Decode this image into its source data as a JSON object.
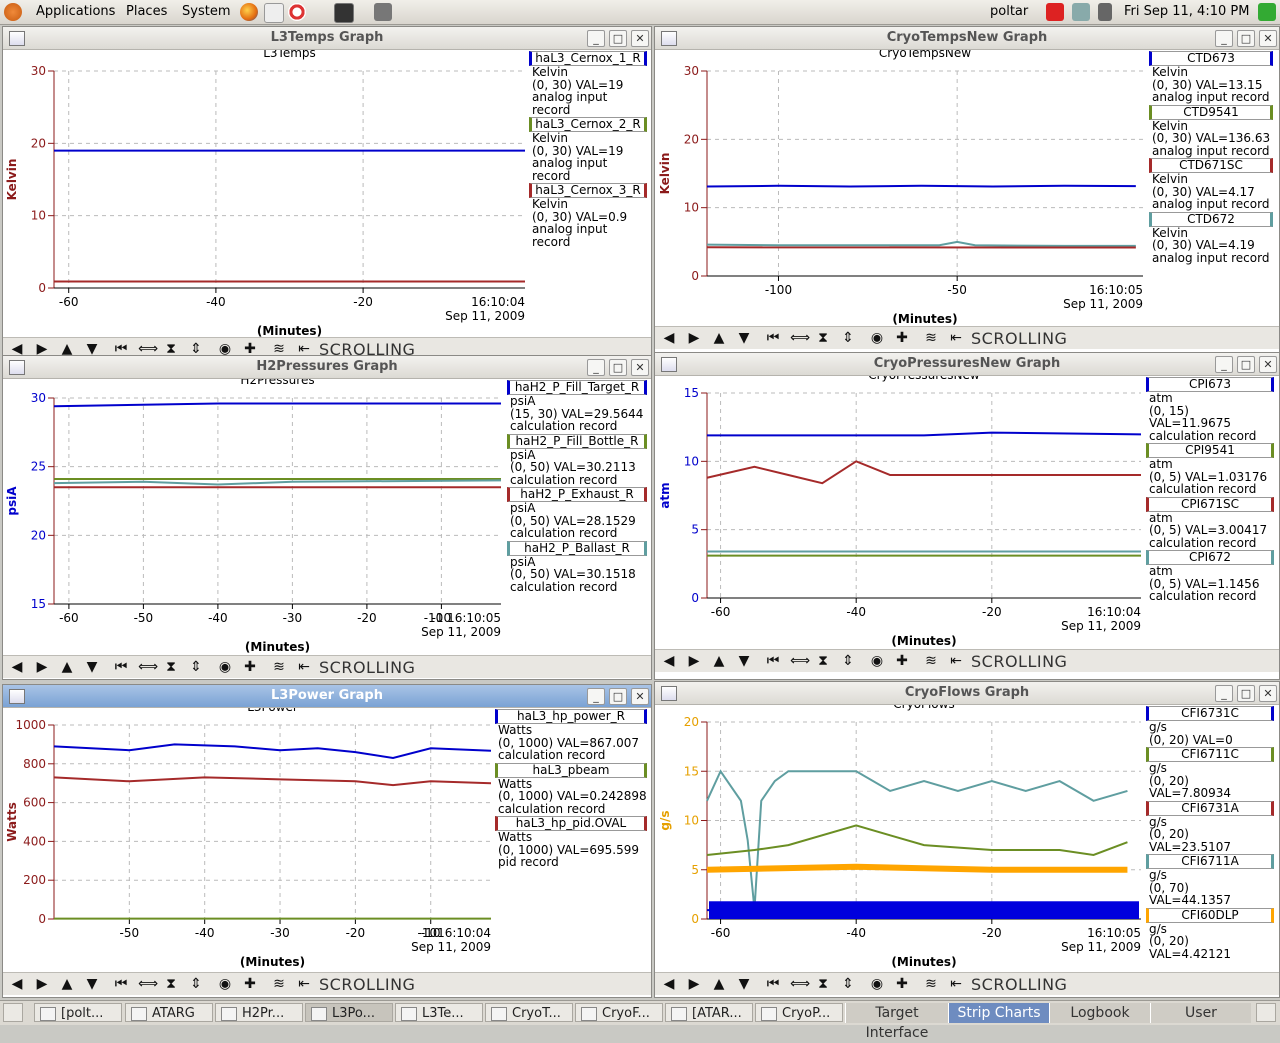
{
  "topbar": {
    "menus": [
      "Applications",
      "Places",
      "System"
    ],
    "user": "poltar",
    "clock": "Fri Sep 11,  4:10 PM"
  },
  "windows": [
    {
      "title": "L3Temps Graph",
      "chart_title": "L3Temps",
      "ylabel": "Kelvin",
      "ylabel_color": "#8b1a1a",
      "timestamp": "16:10:04",
      "date": "Sep 11, 2009",
      "xlabel": "(Minutes)",
      "status": "SCROLLING",
      "legend": [
        {
          "name": "haL3_Cernox_1_R",
          "lines": [
            "Kelvin",
            "(0, 30) VAL=19",
            "analog input record"
          ],
          "color": "#0000cc"
        },
        {
          "name": "haL3_Cernox_2_R",
          "lines": [
            "Kelvin",
            "(0, 30) VAL=19",
            "analog input record"
          ],
          "color": "#6b8e23"
        },
        {
          "name": "haL3_Cernox_3_R",
          "lines": [
            "Kelvin",
            "(0, 30) VAL=0.9",
            "analog input record"
          ],
          "color": "#a52a2a"
        }
      ]
    },
    {
      "title": "CryoTempsNew Graph",
      "chart_title": "CryoTempsNew",
      "ylabel": "Kelvin",
      "ylabel_color": "#8b1a1a",
      "timestamp": "16:10:05",
      "date": "Sep 11, 2009",
      "xlabel": "(Minutes)",
      "status": "SCROLLING",
      "legend": [
        {
          "name": "CTD673",
          "lines": [
            "Kelvin",
            "(0, 30) VAL=13.15",
            "analog input record"
          ],
          "color": "#0000cc"
        },
        {
          "name": "CTD9541",
          "lines": [
            "Kelvin",
            "(0, 30) VAL=136.63",
            "analog input record"
          ],
          "color": "#6b8e23"
        },
        {
          "name": "CTD671SC",
          "lines": [
            "Kelvin",
            "(0, 30) VAL=4.17",
            "analog input record"
          ],
          "color": "#a52a2a"
        },
        {
          "name": "CTD672",
          "lines": [
            "Kelvin",
            "(0, 30) VAL=4.19",
            "analog input record"
          ],
          "color": "#5f9ea0"
        }
      ]
    },
    {
      "title": "H2Pressures Graph",
      "chart_title": "H2Pressures",
      "ylabel": "psiA",
      "ylabel_color": "#0000cc",
      "timestamp": "-10 16:10:05",
      "date": "Sep 11, 2009",
      "xlabel": "(Minutes)",
      "status": "SCROLLING",
      "legend": [
        {
          "name": "haH2_P_Fill_Target_R",
          "lines": [
            "psiA",
            "(15, 30) VAL=29.5644",
            "calculation record"
          ],
          "color": "#0000cc"
        },
        {
          "name": "haH2_P_Fill_Bottle_R",
          "lines": [
            "psiA",
            "(0, 50) VAL=30.2113",
            "calculation record"
          ],
          "color": "#6b8e23"
        },
        {
          "name": "haH2_P_Exhaust_R",
          "lines": [
            "psiA",
            "(0, 50) VAL=28.1529",
            "calculation record"
          ],
          "color": "#a52a2a"
        },
        {
          "name": "haH2_P_Ballast_R",
          "lines": [
            "psiA",
            "(0, 50) VAL=30.1518",
            "calculation record"
          ],
          "color": "#5f9ea0"
        }
      ]
    },
    {
      "title": "CryoPressuresNew Graph",
      "chart_title": "CryoPressuresNew",
      "ylabel": "atm",
      "ylabel_color": "#0000cc",
      "timestamp": "16:10:04",
      "date": "Sep 11, 2009",
      "xlabel": "(Minutes)",
      "status": "SCROLLING",
      "legend": [
        {
          "name": "CPI673",
          "lines": [
            "atm",
            "(0, 15) VAL=11.9675",
            "calculation record"
          ],
          "color": "#0000cc"
        },
        {
          "name": "CPI9541",
          "lines": [
            "atm",
            "(0, 5) VAL=1.03176",
            "calculation record"
          ],
          "color": "#6b8e23"
        },
        {
          "name": "CPI671SC",
          "lines": [
            "atm",
            "(0, 5) VAL=3.00417",
            "calculation record"
          ],
          "color": "#a52a2a"
        },
        {
          "name": "CPI672",
          "lines": [
            "atm",
            "(0, 5) VAL=1.1456",
            "calculation record"
          ],
          "color": "#5f9ea0"
        }
      ]
    },
    {
      "title": "L3Power Graph",
      "chart_title": "L3Power",
      "ylabel": "Watts",
      "ylabel_color": "#8b1a1a",
      "timestamp": "-1016:10:04",
      "date": "Sep 11, 2009",
      "xlabel": "(Minutes)",
      "status": "SCROLLING",
      "legend": [
        {
          "name": "haL3_hp_power_R",
          "lines": [
            "Watts",
            "(0, 1000) VAL=867.007",
            "calculation record"
          ],
          "color": "#0000cc"
        },
        {
          "name": "haL3_pbeam",
          "lines": [
            "Watts",
            "(0, 1000) VAL=0.242898",
            "calculation record"
          ],
          "color": "#6b8e23"
        },
        {
          "name": "haL3_hp_pid.OVAL",
          "lines": [
            "Watts",
            "(0, 1000) VAL=695.599",
            "pid record"
          ],
          "color": "#a52a2a"
        }
      ]
    },
    {
      "title": "CryoFlows Graph",
      "chart_title": "CryoFlows",
      "ylabel": "g/s",
      "ylabel_color": "#e6a000",
      "timestamp": "16:10:05",
      "date": "Sep 11, 2009",
      "xlabel": "(Minutes)",
      "status": "SCROLLING",
      "legend": [
        {
          "name": "CFI6731C",
          "lines": [
            "g/s",
            "(0, 20) VAL=0"
          ],
          "color": "#0000cc"
        },
        {
          "name": "CFI6711C",
          "lines": [
            "g/s",
            "(0, 20) VAL=7.80934"
          ],
          "color": "#6b8e23"
        },
        {
          "name": "CFI6731A",
          "lines": [
            "g/s",
            "(0, 20) VAL=23.5107"
          ],
          "color": "#a52a2a"
        },
        {
          "name": "CFI6711A",
          "lines": [
            "g/s",
            "(0, 70) VAL=44.1357"
          ],
          "color": "#5f9ea0"
        },
        {
          "name": "CFI60DLP",
          "lines": [
            "g/s",
            "(0, 20) VAL=4.42121"
          ],
          "color": "#ffa500"
        }
      ]
    }
  ],
  "chart_data": [
    {
      "type": "line",
      "title": "L3Temps",
      "ylabel": "Kelvin",
      "xlabel": "(Minutes)",
      "ylim": [
        0,
        30
      ],
      "xlim": [
        -62,
        2
      ],
      "yticks": [
        0,
        10,
        20,
        30
      ],
      "xticks": [
        -60,
        -40,
        -20
      ],
      "grid": true,
      "legend_position": "right",
      "series": [
        {
          "name": "haL3_Cernox_1_R",
          "color": "#0000cc",
          "x": [
            -62,
            2
          ],
          "y": [
            19,
            19
          ]
        },
        {
          "name": "haL3_Cernox_3_R",
          "color": "#a52a2a",
          "x": [
            -62,
            2
          ],
          "y": [
            0.9,
            0.9
          ]
        }
      ]
    },
    {
      "type": "line",
      "title": "CryoTempsNew",
      "ylabel": "Kelvin",
      "xlabel": "(Minutes)",
      "ylim": [
        0,
        30
      ],
      "xlim": [
        -120,
        2
      ],
      "yticks": [
        0,
        10,
        20,
        30
      ],
      "xticks": [
        -100,
        -50
      ],
      "grid": true,
      "legend_position": "right",
      "series": [
        {
          "name": "CTD673",
          "color": "#0000cc",
          "x": [
            -120,
            -100,
            -80,
            -60,
            -40,
            -20,
            0
          ],
          "y": [
            13.1,
            13.2,
            13.1,
            13.2,
            13.1,
            13.2,
            13.15
          ]
        },
        {
          "name": "CTD672",
          "color": "#5f9ea0",
          "x": [
            -120,
            -100,
            -80,
            -55,
            -50,
            -45,
            -20,
            0
          ],
          "y": [
            4.6,
            4.5,
            4.5,
            4.5,
            5.0,
            4.5,
            4.4,
            4.4
          ]
        },
        {
          "name": "CTD671SC",
          "color": "#a52a2a",
          "x": [
            -120,
            0
          ],
          "y": [
            4.2,
            4.17
          ]
        }
      ]
    },
    {
      "type": "line",
      "title": "H2Pressures",
      "ylabel": "psiA",
      "xlabel": "(Minutes)",
      "ylim": [
        15,
        30
      ],
      "xlim": [
        -62,
        -2
      ],
      "yticks": [
        15,
        20,
        25,
        30
      ],
      "xticks": [
        -60,
        -50,
        -40,
        -30,
        -20,
        -10
      ],
      "grid": true,
      "legend_position": "right",
      "series": [
        {
          "name": "haH2_P_Fill_Target_R",
          "color": "#0000cc",
          "x": [
            -62,
            -40,
            -20,
            -2
          ],
          "y": [
            29.4,
            29.6,
            29.6,
            29.6
          ]
        },
        {
          "name": "haH2_P_Fill_Bottle_R",
          "color": "#6b8e23",
          "x": [
            -62,
            -2
          ],
          "y": [
            24.1,
            24.1
          ]
        },
        {
          "name": "haH2_P_Ballast_R",
          "color": "#5f9ea0",
          "x": [
            -62,
            -50,
            -40,
            -30,
            -2
          ],
          "y": [
            23.8,
            23.9,
            23.7,
            23.9,
            24.0
          ]
        },
        {
          "name": "haH2_P_Exhaust_R",
          "color": "#a52a2a",
          "x": [
            -62,
            -2
          ],
          "y": [
            23.5,
            23.5
          ]
        }
      ]
    },
    {
      "type": "line",
      "title": "CryoPressuresNew",
      "ylabel": "atm",
      "xlabel": "(Minutes)",
      "ylim": [
        0,
        15
      ],
      "xlim": [
        -62,
        2
      ],
      "yticks": [
        0,
        5,
        10,
        15
      ],
      "xticks": [
        -60,
        -40,
        -20
      ],
      "grid": true,
      "legend_position": "right",
      "series": [
        {
          "name": "CPI673",
          "color": "#0000cc",
          "x": [
            -62,
            -30,
            -20,
            2
          ],
          "y": [
            11.9,
            11.9,
            12.1,
            11.97
          ]
        },
        {
          "name": "CPI9541",
          "color": "#a52a2a",
          "x": [
            -62,
            -55,
            -50,
            -45,
            -40,
            -35,
            -20,
            2
          ],
          "y": [
            8.8,
            9.6,
            9.0,
            8.4,
            10.0,
            9.0,
            9.0,
            9.0
          ]
        },
        {
          "name": "CPI672",
          "color": "#5f9ea0",
          "x": [
            -62,
            2
          ],
          "y": [
            3.4,
            3.4
          ]
        },
        {
          "name": "CPI671SC",
          "color": "#6b8e23",
          "x": [
            -62,
            2
          ],
          "y": [
            3.1,
            3.1
          ]
        }
      ]
    },
    {
      "type": "line",
      "title": "L3Power",
      "ylabel": "Watts",
      "xlabel": "(Minutes)",
      "ylim": [
        0,
        1000
      ],
      "xlim": [
        -60,
        -2
      ],
      "yticks": [
        0,
        200,
        400,
        600,
        800,
        1000
      ],
      "xticks": [
        -50,
        -40,
        -30,
        -20,
        -10
      ],
      "grid": true,
      "legend_position": "right",
      "series": [
        {
          "name": "haL3_hp_power_R",
          "color": "#0000cc",
          "x": [
            -60,
            -50,
            -44,
            -36,
            -30,
            -25,
            -20,
            -15,
            -10,
            -2
          ],
          "y": [
            890,
            870,
            900,
            890,
            870,
            880,
            860,
            830,
            880,
            867
          ]
        },
        {
          "name": "haL3_hp_pid.OVAL",
          "color": "#a52a2a",
          "x": [
            -60,
            -50,
            -40,
            -30,
            -20,
            -15,
            -10,
            -2
          ],
          "y": [
            730,
            710,
            730,
            720,
            710,
            690,
            710,
            700
          ]
        },
        {
          "name": "haL3_pbeam",
          "color": "#6b8e23",
          "x": [
            -60,
            -2
          ],
          "y": [
            2,
            2
          ]
        }
      ]
    },
    {
      "type": "line",
      "title": "CryoFlows",
      "ylabel": "g/s",
      "xlabel": "(Minutes)",
      "ylim": [
        0,
        20
      ],
      "xlim": [
        -62,
        2
      ],
      "yticks": [
        0,
        5,
        10,
        15,
        20
      ],
      "xticks": [
        -60,
        -40,
        -20
      ],
      "grid": true,
      "legend_position": "right",
      "series": [
        {
          "name": "CFI6711A",
          "color": "#5f9ea0",
          "x": [
            -62,
            -60,
            -57,
            -56,
            -55,
            -54,
            -52,
            -50,
            -45,
            -40,
            -35,
            -30,
            -25,
            -20,
            -15,
            -10,
            -5,
            0
          ],
          "y": [
            12,
            15,
            12,
            8,
            1,
            12,
            14,
            15,
            15,
            15,
            13,
            14,
            13,
            14,
            13,
            14,
            12,
            13
          ]
        },
        {
          "name": "CFI6711C",
          "color": "#6b8e23",
          "x": [
            -62,
            -55,
            -50,
            -40,
            -35,
            -30,
            -20,
            -10,
            -5,
            0
          ],
          "y": [
            6.5,
            7,
            7.5,
            9.5,
            8.5,
            7.5,
            7.0,
            7,
            6.5,
            7.8
          ]
        },
        {
          "name": "CFI60DLP",
          "color": "#ffa500",
          "x": [
            -62,
            -40,
            -20,
            0
          ],
          "y": [
            5,
            5.3,
            5,
            5
          ]
        },
        {
          "name": "CFI6731C",
          "color": "#0000cc",
          "x": [
            -62,
            0
          ],
          "y": [
            0.9,
            0.9
          ]
        }
      ]
    }
  ]
}
